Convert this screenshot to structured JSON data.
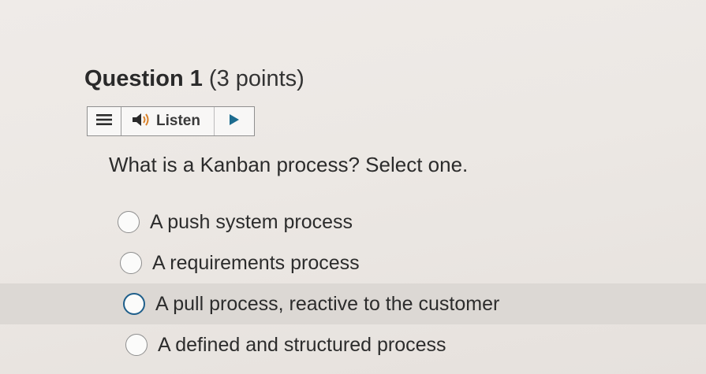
{
  "question": {
    "number_label": "Question 1",
    "points_label": "(3 points)"
  },
  "listen_bar": {
    "menu_icon": "hamburger-menu-icon",
    "speaker_icon": "speaker-icon",
    "listen_label": "Listen",
    "play_icon": "play-icon"
  },
  "prompt": "What is a Kanban process? Select one.",
  "options": [
    {
      "label": "A push system process",
      "selected": false
    },
    {
      "label": "A requirements process",
      "selected": false
    },
    {
      "label": "A pull process, reactive to the customer",
      "selected": false,
      "hovered": true
    },
    {
      "label": "A defined and structured process",
      "selected": false
    }
  ],
  "colors": {
    "focus_ring": "#1f5f8b",
    "hover_bg": "#dcd8d4"
  }
}
